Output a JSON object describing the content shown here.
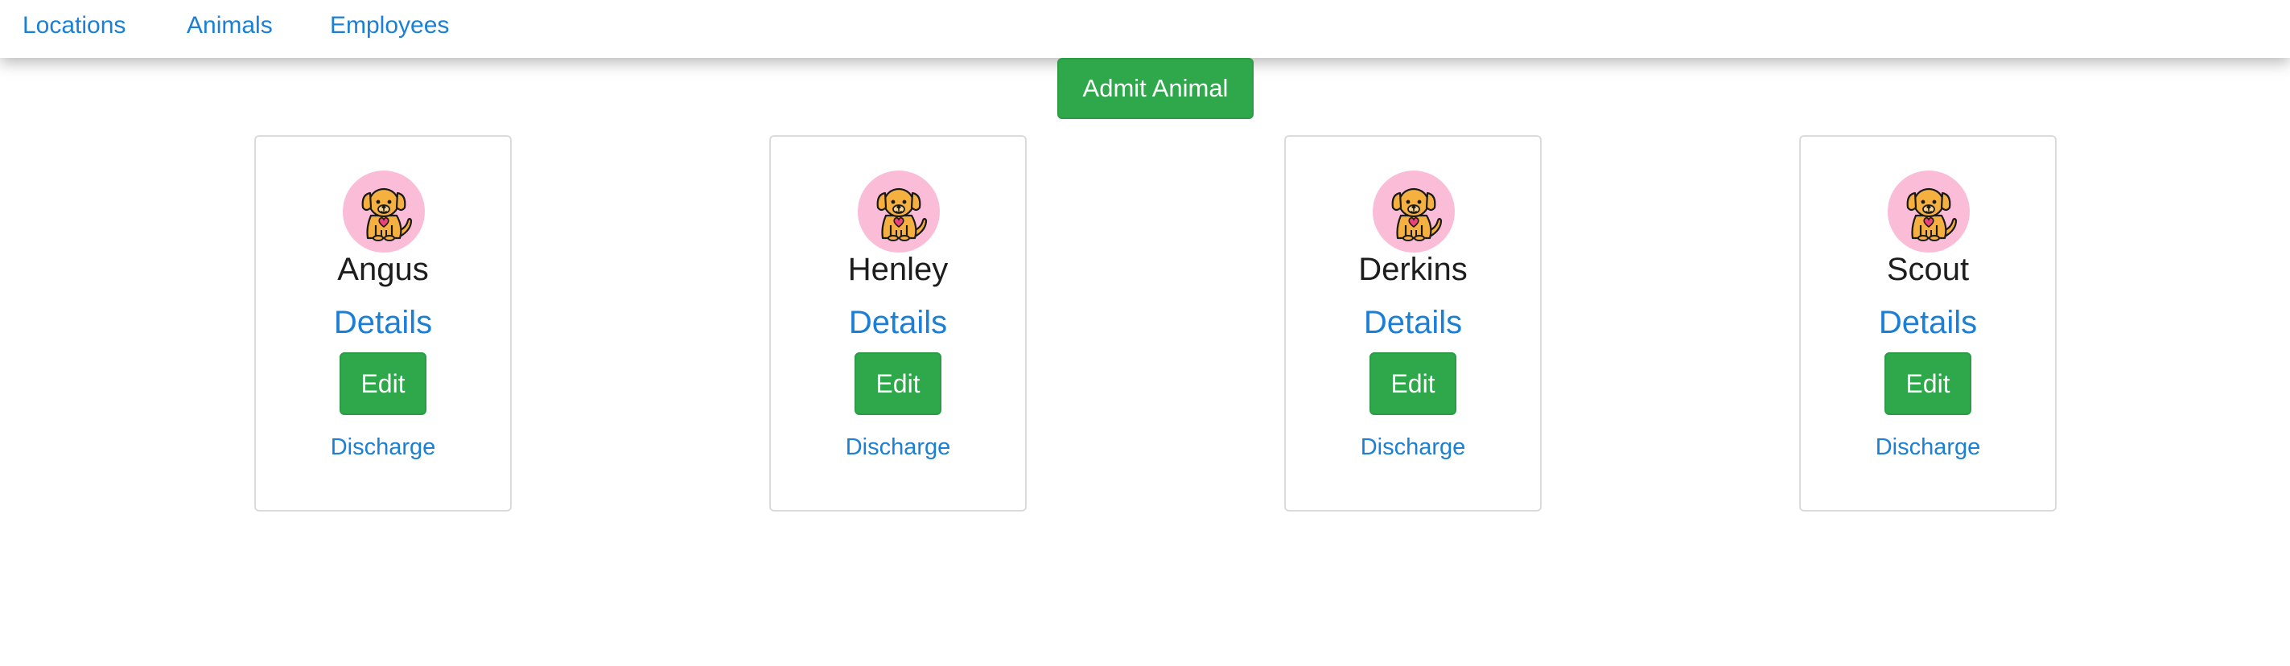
{
  "nav": {
    "items": [
      {
        "label": "Locations"
      },
      {
        "label": "Animals"
      },
      {
        "label": "Employees"
      }
    ]
  },
  "admit_button": {
    "label": "Admit Animal"
  },
  "animals": [
    {
      "name": "Angus",
      "details_label": "Details",
      "edit_label": "Edit",
      "discharge_label": "Discharge",
      "icon": "puppy-icon"
    },
    {
      "name": "Henley",
      "details_label": "Details",
      "edit_label": "Edit",
      "discharge_label": "Discharge",
      "icon": "puppy-icon"
    },
    {
      "name": "Derkins",
      "details_label": "Details",
      "edit_label": "Edit",
      "discharge_label": "Discharge",
      "icon": "puppy-icon"
    },
    {
      "name": "Scout",
      "details_label": "Details",
      "edit_label": "Edit",
      "discharge_label": "Discharge",
      "icon": "puppy-icon"
    }
  ],
  "colors": {
    "link": "#1a7fd6",
    "button": "#2ea84a",
    "avatar_bg": "#fbbcd8",
    "dog_fill": "#f5b040",
    "heart": "#e8447a"
  }
}
